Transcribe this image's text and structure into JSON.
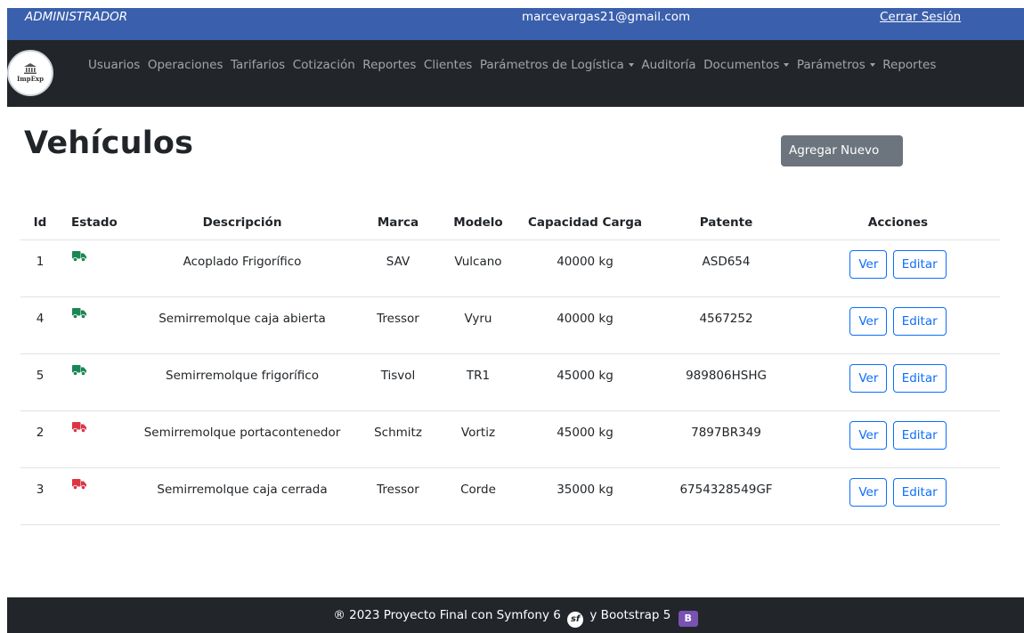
{
  "topbar": {
    "role": "ADMINISTRADOR",
    "email": "marcevargas21@gmail.com",
    "logout": "Cerrar Sesión"
  },
  "logo": {
    "text": "ImpExp"
  },
  "nav": {
    "items": [
      {
        "label": "Usuarios",
        "dropdown": false
      },
      {
        "label": "Operaciones",
        "dropdown": false
      },
      {
        "label": "Tarifarios",
        "dropdown": false
      },
      {
        "label": "Cotización",
        "dropdown": false
      },
      {
        "label": "Reportes",
        "dropdown": false
      },
      {
        "label": "Clientes",
        "dropdown": false
      },
      {
        "label": "Parámetros de Logística",
        "dropdown": true
      },
      {
        "label": "Auditoría",
        "dropdown": false
      },
      {
        "label": "Documentos",
        "dropdown": true
      },
      {
        "label": "Parámetros",
        "dropdown": true
      },
      {
        "label": "Reportes",
        "dropdown": false
      }
    ]
  },
  "page": {
    "title": "Vehículos",
    "add_button": "Agregar Nuevo"
  },
  "table": {
    "headers": {
      "id": "Id",
      "estado": "Estado",
      "descripcion": "Descripción",
      "marca": "Marca",
      "modelo": "Modelo",
      "capacidad": "Capacidad Carga",
      "patente": "Patente",
      "acciones": "Acciones"
    },
    "rows": [
      {
        "id": "1",
        "status": "active",
        "status_icon": "truck-icon",
        "status_color": "#198754",
        "descripcion": "Acoplado Frigorífico",
        "marca": "SAV",
        "modelo": "Vulcano",
        "capacidad": "40000 kg",
        "patente": "ASD654"
      },
      {
        "id": "4",
        "status": "active",
        "status_icon": "truck-icon",
        "status_color": "#198754",
        "descripcion": "Semirremolque caja abierta",
        "marca": "Tressor",
        "modelo": "Vyru",
        "capacidad": "40000 kg",
        "patente": "4567252"
      },
      {
        "id": "5",
        "status": "active",
        "status_icon": "truck-icon",
        "status_color": "#198754",
        "descripcion": "Semirremolque frigorífico",
        "marca": "Tisvol",
        "modelo": "TR1",
        "capacidad": "45000 kg",
        "patente": "989806HSHG"
      },
      {
        "id": "2",
        "status": "inactive",
        "status_icon": "truck-icon",
        "status_color": "#dc3545",
        "descripcion": "Semirremolque portacontenedor",
        "marca": "Schmitz",
        "modelo": "Vortiz",
        "capacidad": "45000 kg",
        "patente": "7897BR349"
      },
      {
        "id": "3",
        "status": "inactive",
        "status_icon": "truck-icon",
        "status_color": "#dc3545",
        "descripcion": "Semirremolque caja cerrada",
        "marca": "Tressor",
        "modelo": "Corde",
        "capacidad": "35000 kg",
        "patente": "6754328549GF"
      }
    ],
    "actions": {
      "view": "Ver",
      "edit": "Editar"
    }
  },
  "footer": {
    "text_before": "® 2023 Proyecto Final con Symfony 6",
    "symfony_icon": "sf",
    "text_middle": "y Bootstrap 5",
    "bootstrap_icon": "B"
  },
  "colors": {
    "topbar": "#3a5fac",
    "navbar": "#222529",
    "add_button": "#6c757d",
    "action_button": "#0d6efd",
    "active_status": "#198754",
    "inactive_status": "#dc3545"
  }
}
